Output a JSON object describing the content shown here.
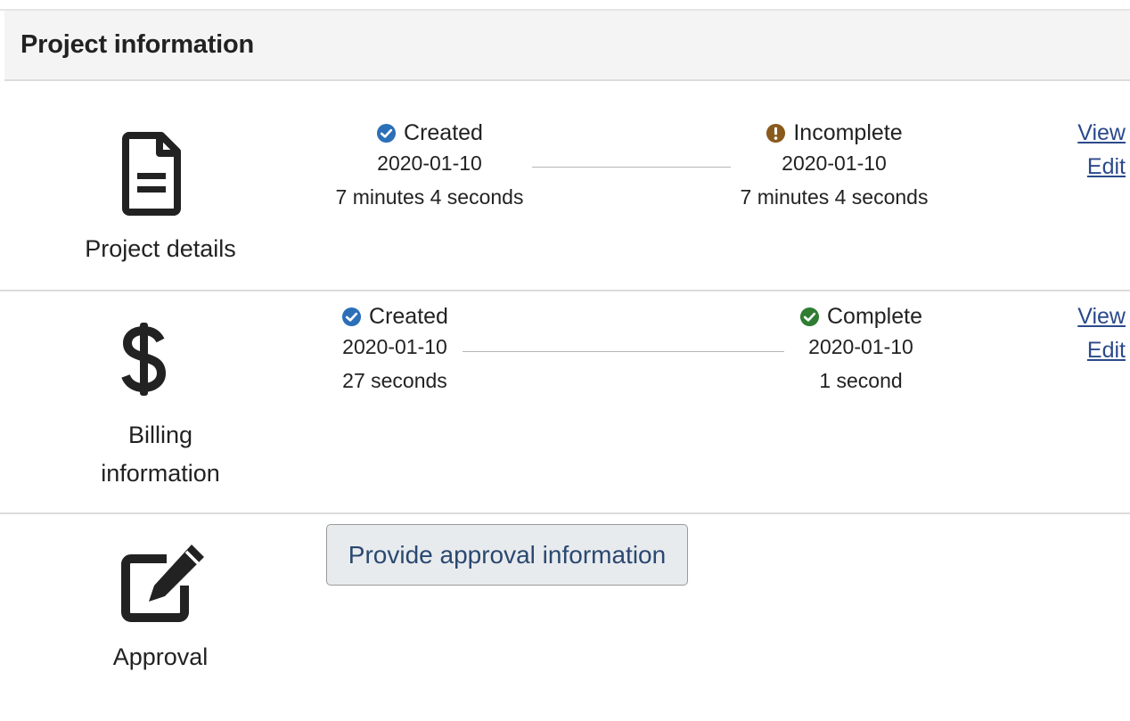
{
  "header": {
    "title": "Project information"
  },
  "sections": {
    "project_details": {
      "label": "Project details",
      "icon": "document-icon",
      "start": {
        "status": "Created",
        "date": "2020-01-10",
        "duration": "7 minutes 4 seconds",
        "icon": "check-circle-icon",
        "color": "#2b6fb8"
      },
      "end": {
        "status": "Incomplete",
        "date": "2020-01-10",
        "duration": "7 minutes 4 seconds",
        "icon": "exclamation-circle-icon",
        "color": "#8a5a1c"
      },
      "links": {
        "view": "View",
        "edit": "Edit"
      }
    },
    "billing": {
      "label_line1": "Billing",
      "label_line2": "information",
      "icon": "dollar-icon",
      "start": {
        "status": "Created",
        "date": "2020-01-10",
        "duration": "27 seconds",
        "icon": "check-circle-icon",
        "color": "#2b6fb8"
      },
      "end": {
        "status": "Complete",
        "date": "2020-01-10",
        "duration": "1 second",
        "icon": "check-circle-icon",
        "color": "#2e7d32"
      },
      "links": {
        "view": "View",
        "edit": "Edit"
      }
    },
    "approval": {
      "label": "Approval",
      "icon": "edit-icon",
      "button_label": "Provide approval information"
    }
  }
}
